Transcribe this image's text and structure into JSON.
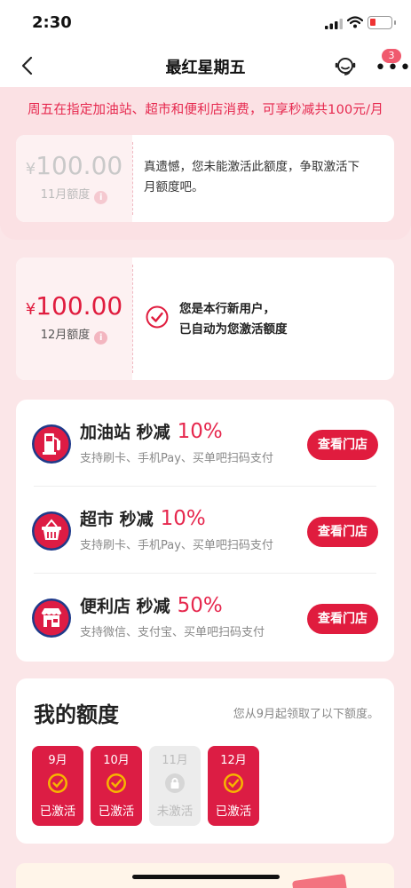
{
  "status_bar": {
    "time": "2:30"
  },
  "nav": {
    "title": "最红星期五",
    "badge_count": "3"
  },
  "banner": "周五在指定加油站、超市和便利店消费，可享秒减共100元/月",
  "coupons": [
    {
      "currency": "¥",
      "amount": "100.00",
      "month_label": "11月额度",
      "info": "i",
      "message_line1": "真遗憾，您未能激活此额度，争取激活下",
      "message_line2": "月额度吧。",
      "state": "expired"
    },
    {
      "currency": "¥",
      "amount": "100.00",
      "month_label": "12月额度",
      "info": "i",
      "message_line1": "您是本行新用户，",
      "message_line2": "已自动为您激活额度",
      "state": "active"
    }
  ],
  "services": [
    {
      "name": "加油站 秒减",
      "discount": "10%",
      "desc": "支持刷卡、手机Pay、买单吧扫码支付",
      "button": "查看门店",
      "icon": "gas-station-icon"
    },
    {
      "name": "超市 秒减",
      "discount": "10%",
      "desc": "支持刷卡、手机Pay、买单吧扫码支付",
      "button": "查看门店",
      "icon": "supermarket-basket-icon"
    },
    {
      "name": "便利店 秒减",
      "discount": "50%",
      "desc": "支持微信、支付宝、买单吧扫码支付",
      "button": "查看门店",
      "icon": "convenience-store-icon"
    }
  ],
  "my_quota": {
    "title": "我的额度",
    "subtitle": "您从9月起领取了以下额度。",
    "items": [
      {
        "month": "9月",
        "status": "已激活",
        "active": true
      },
      {
        "month": "10月",
        "status": "已激活",
        "active": true
      },
      {
        "month": "11月",
        "status": "未激活",
        "active": false
      },
      {
        "month": "12月",
        "status": "已激活",
        "active": true
      }
    ]
  },
  "colors": {
    "accent": "#e01c3e",
    "banner_text": "#e6284e",
    "page_bg": "#fbe6e8"
  }
}
